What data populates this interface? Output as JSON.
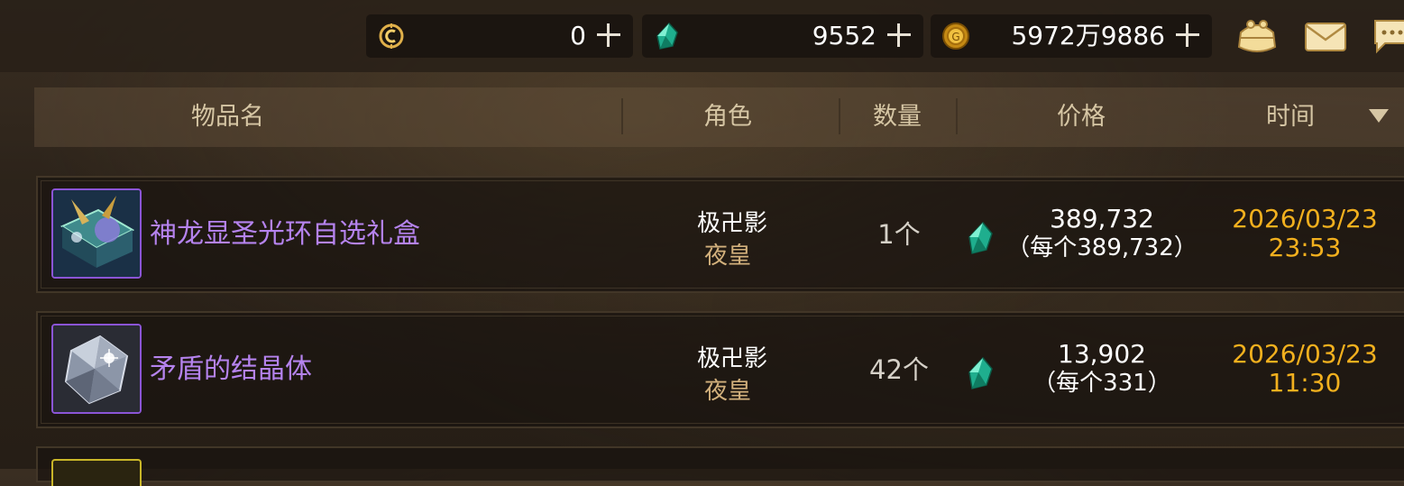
{
  "currencies": [
    {
      "icon": "mileage-coin-icon",
      "value": "0"
    },
    {
      "icon": "cera-gem-icon",
      "value": "9552"
    },
    {
      "icon": "gold-coin-icon",
      "value": "5972万9886"
    }
  ],
  "top_icons": [
    "coin-pouch-icon",
    "mail-icon",
    "chat-icon"
  ],
  "table": {
    "columns": [
      "物品名",
      "角色",
      "数量",
      "价格",
      "时间"
    ],
    "sort_column": "时间",
    "sort_direction": "descending",
    "rows": [
      {
        "item_name": "神龙显圣光环自选礼盒",
        "role_name": "极卍影",
        "role_class": "夜皇",
        "quantity": "1个",
        "price": "389,732",
        "unit_price": "（每个389,732）",
        "date": "2026/03/23",
        "time": "23:53",
        "icon": "gift-box-icon",
        "rarity_color": "#8b55d6"
      },
      {
        "item_name": "矛盾的结晶体",
        "role_name": "极卍影",
        "role_class": "夜皇",
        "quantity": "42个",
        "price": "13,902",
        "unit_price": "（每个331）",
        "date": "2026/03/23",
        "time": "11:30",
        "icon": "crystal-icon",
        "rarity_color": "#8b55d6"
      }
    ]
  },
  "colors": {
    "item_name": "#b583ee",
    "role_class": "#d2b07c",
    "date": "#f2b01e",
    "header_text": "#d6c6a4"
  }
}
